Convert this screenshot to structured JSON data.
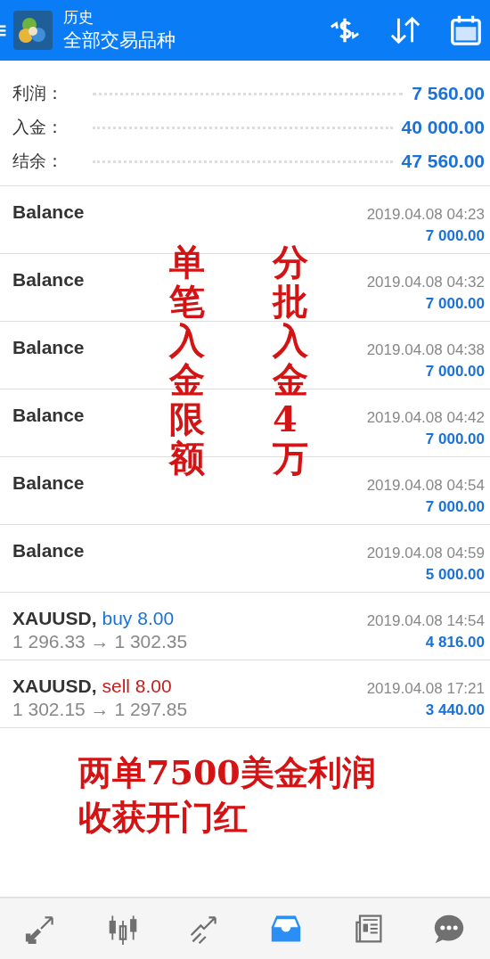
{
  "header": {
    "title": "历史",
    "subtitle": "全部交易品种"
  },
  "summary": [
    {
      "label": "利润：",
      "value": "7 560.00"
    },
    {
      "label": "入金：",
      "value": "40 000.00"
    },
    {
      "label": "结余：",
      "value": "47 560.00"
    }
  ],
  "deals": [
    {
      "kind": "balance",
      "name": "Balance",
      "time": "2019.04.08 04:23",
      "amount": "7 000.00"
    },
    {
      "kind": "balance",
      "name": "Balance",
      "time": "2019.04.08 04:32",
      "amount": "7 000.00"
    },
    {
      "kind": "balance",
      "name": "Balance",
      "time": "2019.04.08 04:38",
      "amount": "7 000.00"
    },
    {
      "kind": "balance",
      "name": "Balance",
      "time": "2019.04.08 04:42",
      "amount": "7 000.00"
    },
    {
      "kind": "balance",
      "name": "Balance",
      "time": "2019.04.08 04:54",
      "amount": "7 000.00"
    },
    {
      "kind": "balance",
      "name": "Balance",
      "time": "2019.04.08 04:59",
      "amount": "5 000.00"
    },
    {
      "kind": "trade",
      "name": "XAUUSD,",
      "sell": false,
      "order": "buy 8.00",
      "prices": "1 296.33 → 1 302.35",
      "time": "2019.04.08 14:54",
      "amount": "4 816.00"
    },
    {
      "kind": "trade",
      "name": "XAUUSD,",
      "sell": true,
      "order": "sell 8.00",
      "prices": "1 302.15 → 1 297.85",
      "time": "2019.04.08 17:21",
      "amount": "3 440.00"
    }
  ],
  "annotations": {
    "columns": [
      "单笔入金限额",
      "分批入金4万"
    ],
    "caption": [
      "两单7500美金利润",
      "收获开门红"
    ]
  },
  "nav": [
    {
      "kind": "trade",
      "selected": false
    },
    {
      "kind": "quotes",
      "selected": false
    },
    {
      "kind": "chart",
      "selected": false
    },
    {
      "kind": "history",
      "selected": true
    },
    {
      "kind": "news",
      "selected": false
    },
    {
      "kind": "chat",
      "selected": false
    }
  ]
}
